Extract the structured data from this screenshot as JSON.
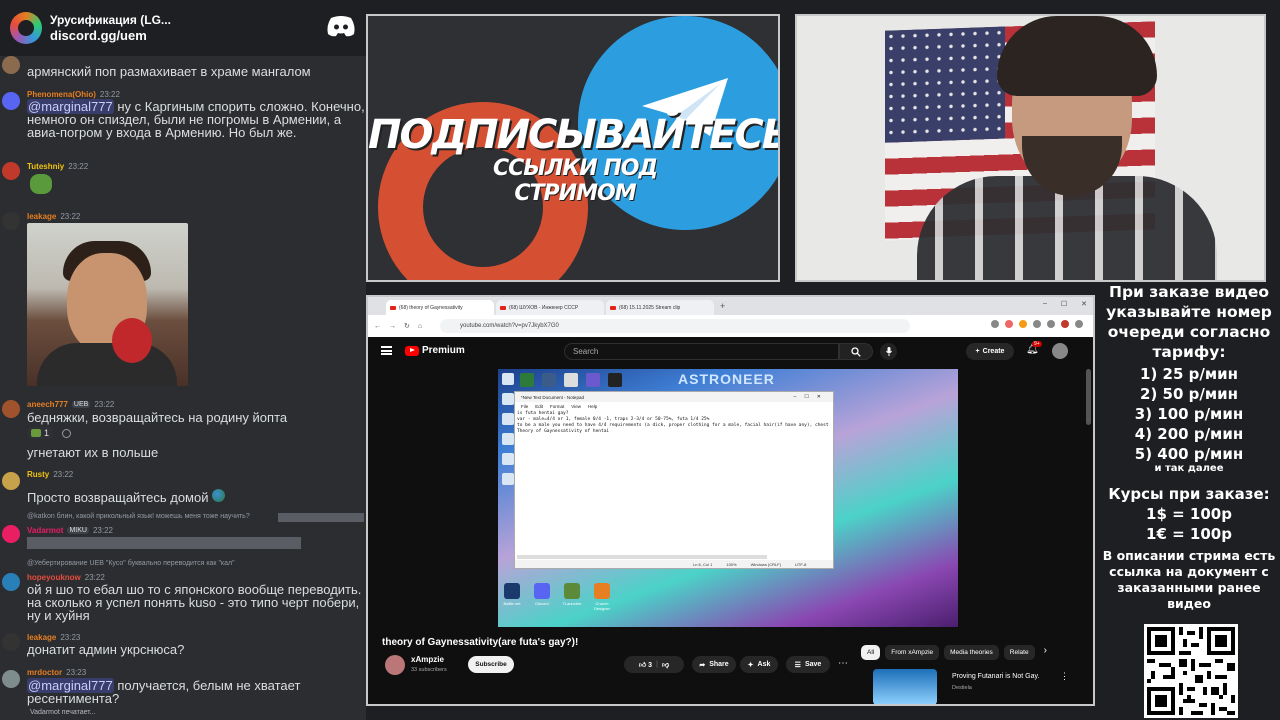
{
  "chat": {
    "server_name": "Урусификация (LG...",
    "server_link": "discord.gg/uem",
    "typing": "Vadarmot печатает...",
    "messages": [
      {
        "text": "армянский поп размахивает в храме мангалом"
      },
      {
        "user": "Phenomena(Ohio)",
        "time": "23:22",
        "user_color": "#e67e22",
        "mention": "@marginal777",
        "text": " ну с Каргиным спорить сложно. Конечно, немного он спиздел, были не погромы в Армении, а авиа-погром у входа в Армению. Но был же."
      },
      {
        "user": "Tuteshniy",
        "time": "23:22",
        "user_color": "#f1c40f"
      },
      {
        "user": "leakage",
        "time": "23:22",
        "user_color": "#e67e22"
      },
      {
        "user": "aneech777",
        "badge": "UEB",
        "time": "23:22",
        "user_color": "#e67e22",
        "text": "бедняжки, возвращайтесь на родину йопта"
      },
      {
        "reaction_count": "1"
      },
      {
        "text": "угнетают их в польше"
      },
      {
        "user": "Rusty",
        "time": "23:22",
        "user_color": "#f1c40f",
        "text": "Просто возвращайтесь домой"
      },
      {
        "reply": "@katkon блин, какой прикольный язык! можешь меня тоже научить?"
      },
      {
        "user": "Vadarmot",
        "badge": "MIKU",
        "time": "23:22",
        "user_color": "#e91e63"
      },
      {
        "reply": "@Уебертирование UEB \"Кусо\" буквально переводится как \"кал\""
      },
      {
        "user": "hopeyouknow",
        "time": "23:22",
        "user_color": "#e74c3c",
        "text": "ой я шо то ебал шо то с японского вообще переводить. на сколько я успел понять kuso - это типо черт побери, ну и хуйня"
      },
      {
        "user": "leakage",
        "time": "23:23",
        "user_color": "#e67e22",
        "text": "донатит админ укрснюса?"
      },
      {
        "user": "mrdoctor",
        "time": "23:23",
        "user_color": "#e67e22",
        "mention": "@marginal777",
        "text": " получается, белым не хватает ресентимента?"
      }
    ]
  },
  "banner": {
    "title": "ПОДПИСЫВАЙТЕСЬ",
    "subtitle": "ССЫЛКИ ПОД СТРИМОМ"
  },
  "browser": {
    "tabs": [
      {
        "label": "(68) theory of Gaynessativity"
      },
      {
        "label": "(68) ШУХОВ - Инженер СССР"
      },
      {
        "label": "(68) 15.11.2025 Stream clip"
      }
    ],
    "url": "youtube.com/watch?v=pv7JkybX7G0",
    "youtube": {
      "brand": "Premium",
      "search_placeholder": "Search",
      "create_label": "Create",
      "bell_count": "9+",
      "video_title": "theory of Gaynessativity(are futa's gay?)!",
      "channel_name": "xAmpzie",
      "channel_subs": "33 subscribers",
      "subscribe_label": "Subscribe",
      "like_count": "3",
      "share_label": "Share",
      "ask_label": "Ask",
      "save_label": "Save",
      "chips": [
        "All",
        "From xAmpzie",
        "Media theories",
        "Relate"
      ],
      "rec_title": "Proving Futanari is Not Gay.",
      "rec_channel": "Destiela"
    },
    "player": {
      "game_title": "ASTRONEER",
      "notepad_title": "*New Text Document - Notepad",
      "notepad_menu": [
        "File",
        "Edit",
        "Format",
        "View",
        "Help"
      ],
      "notepad_lines": [
        "is futa hentai gay?",
        "",
        "var - male=4/4 or 1, female 0/4 -1, traps 2-3/4 or 50-75%, futa 1/4 25%",
        "",
        "to be a male you need to have 4/4 requirements (a dick, proper clothing for a male, facial hair(if have any), chest",
        "",
        "Theory of Gaynessativity of hentai"
      ],
      "notepad_status": [
        "Ln 6, Col 1",
        "100%",
        "Windows (CRLF)",
        "UTF-8"
      ],
      "desk_bottom": [
        "Battle.net",
        "Discord",
        "TLauncher",
        "Crunch Designer"
      ]
    }
  },
  "info": {
    "intro": "При заказе видео указывайте номер очереди согласно тарифу:",
    "tariffs": [
      "1) 25 р/мин",
      "2) 50 р/мин",
      "3) 100 р/мин",
      "4) 200 р/мин",
      "5) 400 р/мин"
    ],
    "more": "и так далее",
    "courses_title": "Курсы при заказе:",
    "courses": [
      "1$ = 100р",
      "1€ = 100р"
    ],
    "desc": "В описании стрима есть ссылка на документ с заказанными ранее видео"
  }
}
